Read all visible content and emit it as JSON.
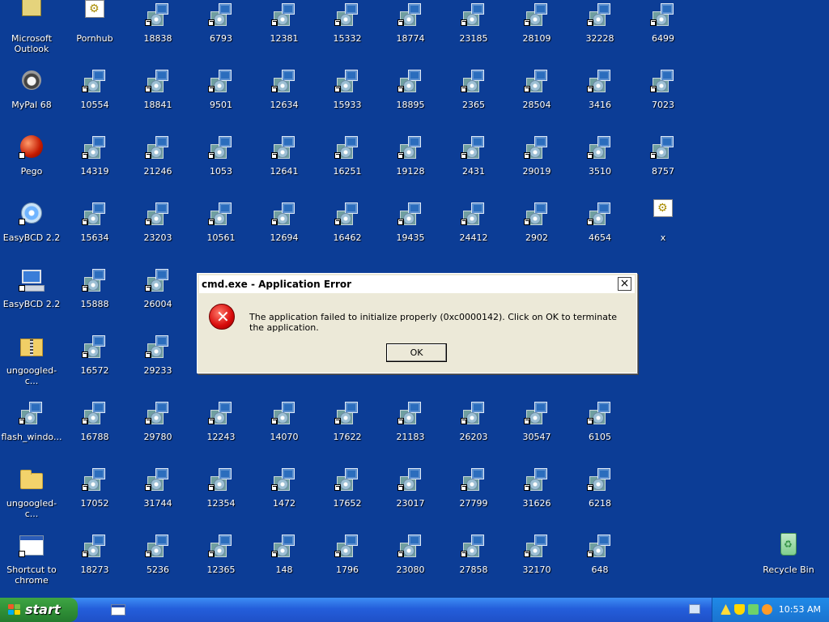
{
  "desktop": {
    "icons": [
      {
        "label": "Microsoft Outlook",
        "type": "outlook"
      },
      {
        "label": "Pornhub",
        "type": "gear"
      },
      {
        "label": "18838",
        "type": "installer"
      },
      {
        "label": "6793",
        "type": "installer"
      },
      {
        "label": "12381",
        "type": "installer"
      },
      {
        "label": "15332",
        "type": "installer"
      },
      {
        "label": "18774",
        "type": "installer"
      },
      {
        "label": "23185",
        "type": "installer"
      },
      {
        "label": "28109",
        "type": "installer"
      },
      {
        "label": "32228",
        "type": "installer"
      },
      {
        "label": "6499",
        "type": "installer"
      },
      {
        "label": "MyPal 68",
        "type": "raccoon"
      },
      {
        "label": "10554",
        "type": "installer"
      },
      {
        "label": "18841",
        "type": "installer"
      },
      {
        "label": "9501",
        "type": "installer"
      },
      {
        "label": "12634",
        "type": "installer"
      },
      {
        "label": "15933",
        "type": "installer"
      },
      {
        "label": "18895",
        "type": "installer"
      },
      {
        "label": "2365",
        "type": "installer"
      },
      {
        "label": "28504",
        "type": "installer"
      },
      {
        "label": "3416",
        "type": "installer"
      },
      {
        "label": "7023",
        "type": "installer"
      },
      {
        "label": "Pego",
        "type": "red"
      },
      {
        "label": "14319",
        "type": "installer"
      },
      {
        "label": "21246",
        "type": "installer"
      },
      {
        "label": "1053",
        "type": "installer"
      },
      {
        "label": "12641",
        "type": "installer"
      },
      {
        "label": "16251",
        "type": "installer"
      },
      {
        "label": "19128",
        "type": "installer"
      },
      {
        "label": "2431",
        "type": "installer"
      },
      {
        "label": "29019",
        "type": "installer"
      },
      {
        "label": "3510",
        "type": "installer"
      },
      {
        "label": "8757",
        "type": "installer"
      },
      {
        "label": "EasyBCD 2.2",
        "type": "disk"
      },
      {
        "label": "15634",
        "type": "installer"
      },
      {
        "label": "23203",
        "type": "installer"
      },
      {
        "label": "10561",
        "type": "installer"
      },
      {
        "label": "12694",
        "type": "installer"
      },
      {
        "label": "16462",
        "type": "installer"
      },
      {
        "label": "19435",
        "type": "installer"
      },
      {
        "label": "24412",
        "type": "installer"
      },
      {
        "label": "2902",
        "type": "installer"
      },
      {
        "label": "4654",
        "type": "installer"
      },
      {
        "label": "x",
        "type": "gear"
      },
      {
        "label": "EasyBCD 2.2",
        "type": "pc"
      },
      {
        "label": "15888",
        "type": "installer"
      },
      {
        "label": "26004",
        "type": "installer"
      },
      {
        "label": "ungoogled-c...",
        "type": "zip"
      },
      {
        "label": "16572",
        "type": "installer"
      },
      {
        "label": "29233",
        "type": "installer"
      },
      {
        "label": "flash_windo...",
        "type": "installer"
      },
      {
        "label": "16788",
        "type": "installer"
      },
      {
        "label": "29780",
        "type": "installer"
      },
      {
        "label": "12243",
        "type": "installer"
      },
      {
        "label": "14070",
        "type": "installer"
      },
      {
        "label": "17622",
        "type": "installer"
      },
      {
        "label": "21183",
        "type": "installer"
      },
      {
        "label": "26203",
        "type": "installer"
      },
      {
        "label": "30547",
        "type": "installer"
      },
      {
        "label": "6105",
        "type": "installer"
      },
      {
        "label": "ungoogled-c...",
        "type": "folder"
      },
      {
        "label": "17052",
        "type": "installer"
      },
      {
        "label": "31744",
        "type": "installer"
      },
      {
        "label": "12354",
        "type": "installer"
      },
      {
        "label": "1472",
        "type": "installer"
      },
      {
        "label": "17652",
        "type": "installer"
      },
      {
        "label": "23017",
        "type": "installer"
      },
      {
        "label": "27799",
        "type": "installer"
      },
      {
        "label": "31626",
        "type": "installer"
      },
      {
        "label": "6218",
        "type": "installer"
      },
      {
        "label": "Shortcut to chrome",
        "type": "generic"
      },
      {
        "label": "18273",
        "type": "installer"
      },
      {
        "label": "5236",
        "type": "installer"
      },
      {
        "label": "12365",
        "type": "installer"
      },
      {
        "label": "148",
        "type": "installer"
      },
      {
        "label": "1796",
        "type": "installer"
      },
      {
        "label": "23080",
        "type": "installer"
      },
      {
        "label": "27858",
        "type": "installer"
      },
      {
        "label": "32170",
        "type": "installer"
      },
      {
        "label": "648",
        "type": "installer"
      },
      {
        "label": "Recycle Bin",
        "type": "recycle"
      }
    ]
  },
  "dialog": {
    "title": "cmd.exe - Application Error",
    "close_label": "×",
    "message": "The application failed to initialize properly (0xc0000142). Click on OK to terminate the application.",
    "ok_label": "OK"
  },
  "taskbar": {
    "start_label": "start",
    "clock": "10:53 AM"
  }
}
